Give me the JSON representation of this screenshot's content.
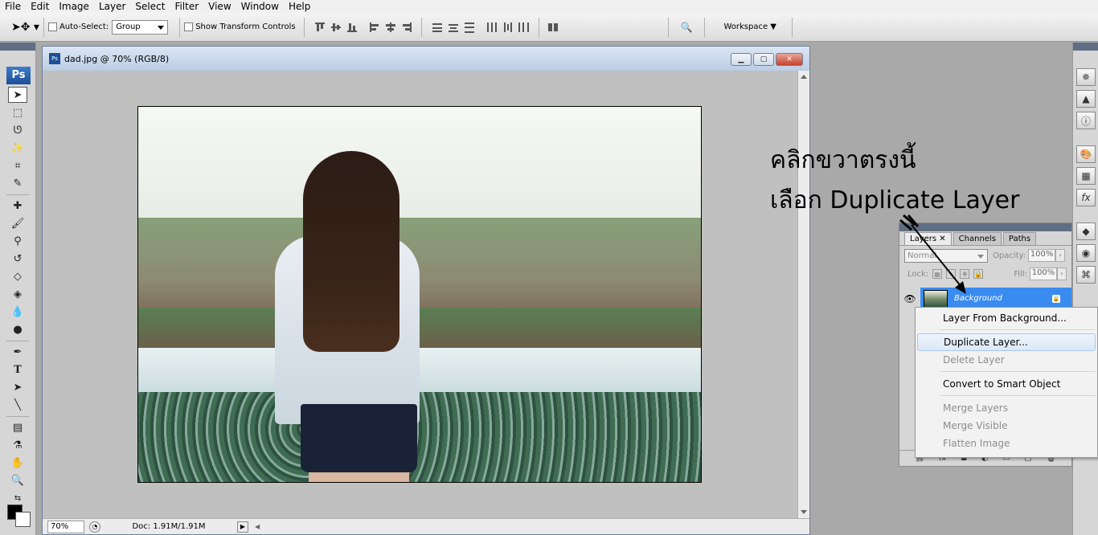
{
  "menubar": [
    "File",
    "Edit",
    "Image",
    "Layer",
    "Select",
    "Filter",
    "View",
    "Window",
    "Help"
  ],
  "options": {
    "auto_select_label": "Auto-Select:",
    "auto_select_value": "Group",
    "show_transform_label": "Show Transform Controls",
    "workspace_label": "Workspace"
  },
  "toolbar": {
    "logo": "Ps"
  },
  "document": {
    "title": "dad.jpg @ 70% (RGB/8)",
    "zoom": "70%",
    "doc_info": "Doc: 1.91M/1.91M"
  },
  "layers_panel": {
    "tabs": [
      "Layers",
      "Channels",
      "Paths"
    ],
    "blend_mode": "Normal",
    "opacity_label": "Opacity:",
    "opacity_value": "100%",
    "lock_label": "Lock:",
    "fill_label": "Fill:",
    "fill_value": "100%",
    "layer_name": "Background"
  },
  "context_menu": {
    "items": [
      "Layer From Background...",
      "Duplicate Layer...",
      "Delete Layer",
      "Convert to Smart Object",
      "Merge Layers",
      "Merge Visible",
      "Flatten Image"
    ]
  },
  "annotation": {
    "line1": "คลิกขวาตรงนี้",
    "line2": "เลือก Duplicate Layer"
  },
  "colors": {
    "selection_blue": "#3a8bf0",
    "ps_blue": "#1d4f96"
  }
}
